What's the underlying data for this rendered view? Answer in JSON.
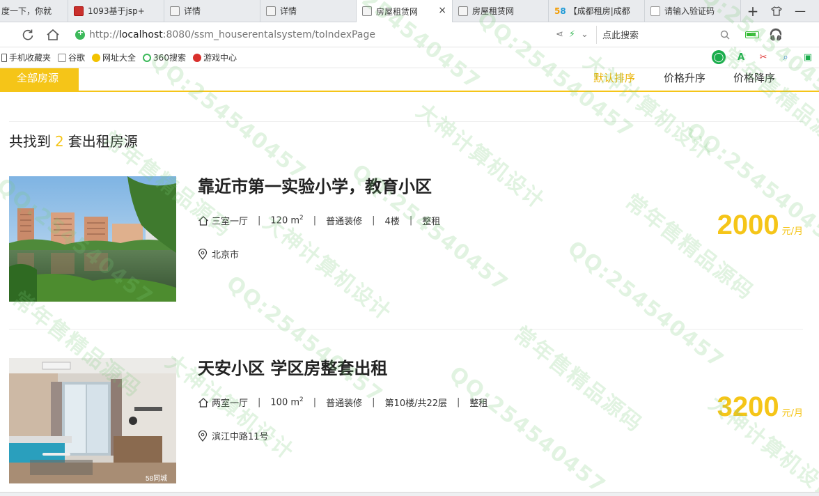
{
  "browser": {
    "tabs": [
      {
        "title": "度一下，你就",
        "icon": "none-icon"
      },
      {
        "title": "1093基于jsp+",
        "icon": "red-square-icon"
      },
      {
        "title": "详情",
        "icon": "page-icon"
      },
      {
        "title": "详情",
        "icon": "page-icon"
      },
      {
        "title": "房屋租赁网",
        "icon": "page-icon",
        "active": true
      },
      {
        "title": "房屋租赁网",
        "icon": "page-icon"
      },
      {
        "title": "【成都租房|成都",
        "icon": "58-logo-icon"
      },
      {
        "title": "请输入验证码",
        "icon": "document-icon"
      }
    ],
    "url_prefix": "http://",
    "url_host": "localhost",
    "url_rest": ":8080/ssm_houserentalsystem/toIndexPage",
    "search_placeholder": "点此搜索",
    "bookmarks": [
      {
        "label": "手机收藏夹",
        "icon": "mobile-icon"
      },
      {
        "label": "谷歌",
        "icon": "document-icon"
      },
      {
        "label": "网址大全",
        "icon": "nav-icon"
      },
      {
        "label": "360搜索",
        "icon": "search-360-icon"
      },
      {
        "label": "游戏中心",
        "icon": "game-icon"
      }
    ]
  },
  "filter": {
    "all_label": "全部房源",
    "sort_default": "默认排序",
    "sort_asc": "价格升序",
    "sort_desc": "价格降序"
  },
  "result": {
    "prefix": "共找到",
    "count": "2",
    "suffix": "套出租房源"
  },
  "listings": [
    {
      "title": "靠近市第一实验小学，教育小区",
      "layout": "三室一厅",
      "area": "120 m",
      "area_sup": "2",
      "decoration": "普通装修",
      "floor": "4楼",
      "rent_type": "整租",
      "address": "北京市",
      "price": "2000",
      "unit": "元/月"
    },
    {
      "title": "天安小区 学区房整套出租",
      "layout": "两室一厅",
      "area": "100 m",
      "area_sup": "2",
      "decoration": "普通装修",
      "floor": "第10楼/共22层",
      "rent_type": "整租",
      "address": "滨江中路11号",
      "price": "3200",
      "unit": "元/月",
      "photo_label": "58同城"
    }
  ],
  "watermark": {
    "text_a": "QQ:254540457",
    "text_b": "大神计算机设计",
    "text_c": "常年售精品源码"
  },
  "colors": {
    "accent": "#f5c518",
    "sort_active": "#e9b100",
    "text": "#222222"
  }
}
